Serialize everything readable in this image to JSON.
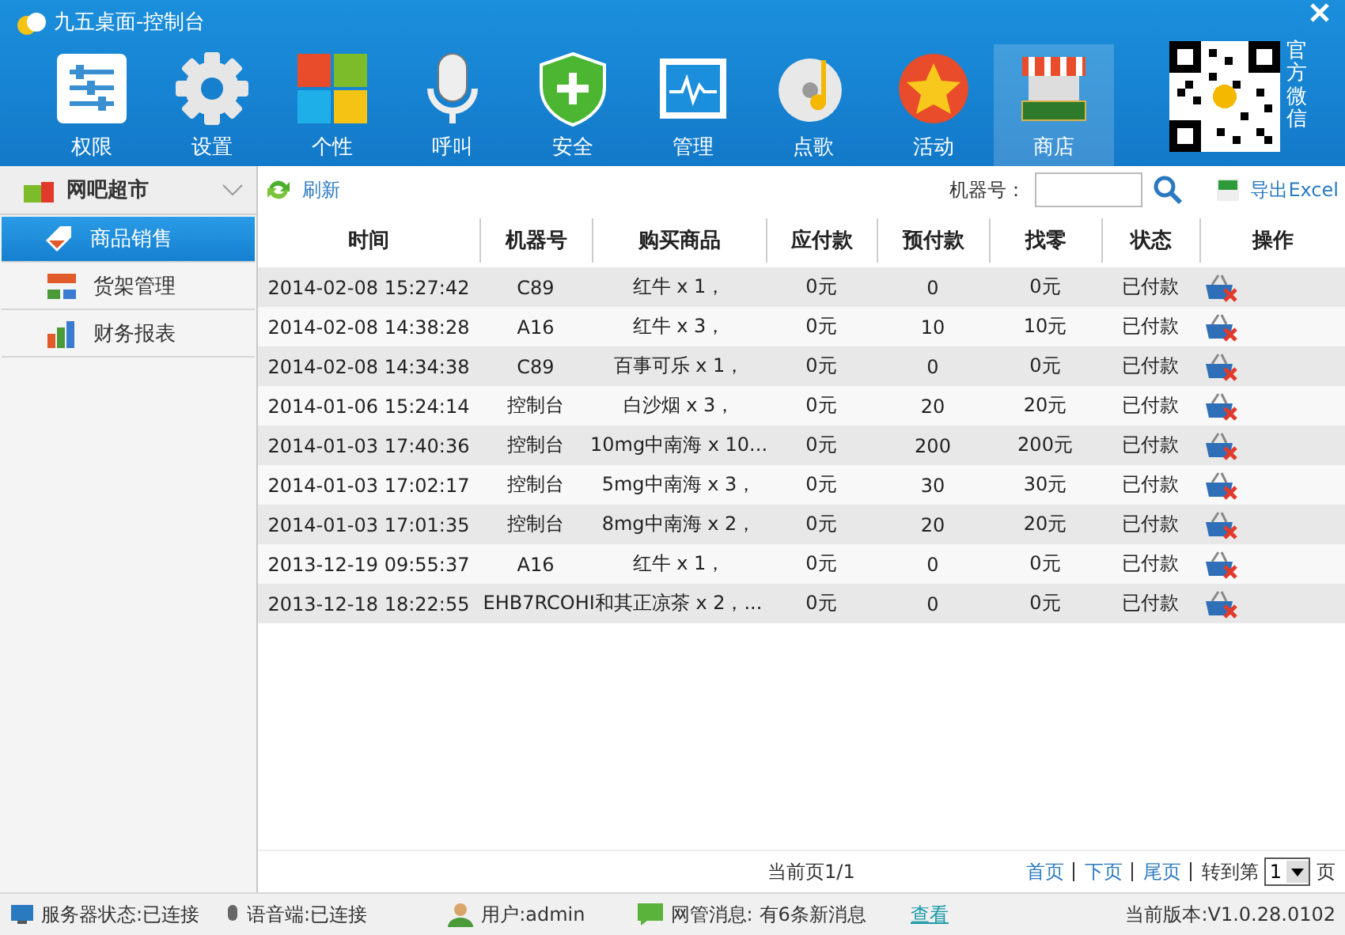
{
  "window": {
    "title": "九五桌面-控制台"
  },
  "nav": [
    {
      "label": "权限",
      "kind": "sliders",
      "selected": false
    },
    {
      "label": "设置",
      "kind": "gear",
      "selected": false
    },
    {
      "label": "个性",
      "kind": "tiles",
      "selected": false
    },
    {
      "label": "呼叫",
      "kind": "mic",
      "selected": false
    },
    {
      "label": "安全",
      "kind": "shield",
      "selected": false
    },
    {
      "label": "管理",
      "kind": "monitor",
      "selected": false
    },
    {
      "label": "点歌",
      "kind": "disc",
      "selected": false
    },
    {
      "label": "活动",
      "kind": "star",
      "selected": false
    },
    {
      "label": "商店",
      "kind": "market",
      "selected": true
    }
  ],
  "wechat": {
    "label": "官方微信"
  },
  "sidebar": {
    "header": "网吧超市",
    "items": [
      {
        "label": "商品销售",
        "kind": "tag",
        "selected": true
      },
      {
        "label": "货架管理",
        "kind": "shelf",
        "selected": false
      },
      {
        "label": "财务报表",
        "kind": "chart",
        "selected": false
      }
    ]
  },
  "toolbar": {
    "refresh": "刷新",
    "machine_label": "机器号：",
    "export": "导出Excel"
  },
  "table": {
    "columns": [
      "时间",
      "机器号",
      "购买商品",
      "应付款",
      "预付款",
      "找零",
      "状态",
      "操作"
    ],
    "rows": [
      [
        "2014-02-08 15:27:42",
        "C89",
        "红牛 x 1，",
        "0元",
        "0",
        "0元",
        "已付款"
      ],
      [
        "2014-02-08 14:38:28",
        "A16",
        "红牛 x 3，",
        "0元",
        "10",
        "10元",
        "已付款"
      ],
      [
        "2014-02-08 14:34:38",
        "C89",
        "百事可乐 x 1，",
        "0元",
        "0",
        "0元",
        "已付款"
      ],
      [
        "2014-01-06 15:24:14",
        "控制台",
        "白沙烟 x 3，",
        "0元",
        "20",
        "20元",
        "已付款"
      ],
      [
        "2014-01-03 17:40:36",
        "控制台",
        "10mg中南海 x 10...",
        "0元",
        "200",
        "200元",
        "已付款"
      ],
      [
        "2014-01-03 17:02:17",
        "控制台",
        "5mg中南海 x 3，",
        "0元",
        "30",
        "30元",
        "已付款"
      ],
      [
        "2014-01-03 17:01:35",
        "控制台",
        "8mg中南海 x 2，",
        "0元",
        "20",
        "20元",
        "已付款"
      ],
      [
        "2013-12-19 09:55:37",
        "A16",
        "红牛 x 1，",
        "0元",
        "0",
        "0元",
        "已付款"
      ],
      [
        "2013-12-18 18:22:55",
        "EHB7RCOHI和其正凉茶 x 2，...",
        "",
        "0元",
        "0",
        "0元",
        "已付款"
      ]
    ]
  },
  "pager": {
    "info": "当前页1/1",
    "first": "首页",
    "next": "下页",
    "last": "尾页",
    "goto": "转到第",
    "page": "1",
    "suffix": "页"
  },
  "status_bar": {
    "server": "服务器状态:已连接",
    "voice": "语音端:已连接",
    "user": "用户:admin",
    "msg_label": "网管消息:",
    "msg": "有6条新消息",
    "view": "查看",
    "version": "当前版本:V1.0.28.0102"
  }
}
